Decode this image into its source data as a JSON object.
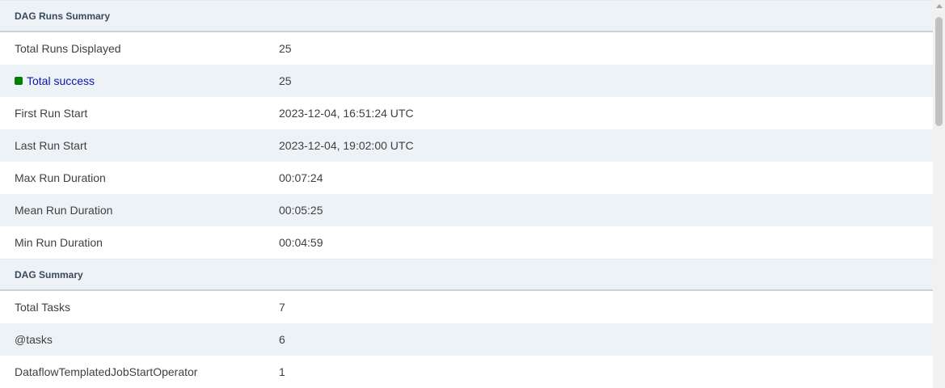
{
  "dag_runs_summary": {
    "title": "DAG Runs Summary",
    "rows": [
      {
        "label": "Total Runs Displayed",
        "value": "25"
      },
      {
        "label": "Total success",
        "value": "25",
        "state_color": "#008000",
        "link_color": "#0b14b3"
      },
      {
        "label": "First Run Start",
        "value": "2023-12-04, 16:51:24 UTC"
      },
      {
        "label": "Last Run Start",
        "value": "2023-12-04, 19:02:00 UTC"
      },
      {
        "label": "Max Run Duration",
        "value": "00:07:24"
      },
      {
        "label": "Mean Run Duration",
        "value": "00:05:25"
      },
      {
        "label": "Min Run Duration",
        "value": "00:04:59"
      }
    ]
  },
  "dag_summary": {
    "title": "DAG Summary",
    "rows": [
      {
        "label": "Total Tasks",
        "value": "7"
      },
      {
        "label": "@tasks",
        "value": "6"
      },
      {
        "label": "DataflowTemplatedJobStartOperator",
        "value": "1"
      }
    ]
  },
  "colors": {
    "header_bg": "#edf2f7",
    "alt_row_bg": "#edf2f7",
    "success_state": "#008000",
    "link": "#0b14b3"
  }
}
